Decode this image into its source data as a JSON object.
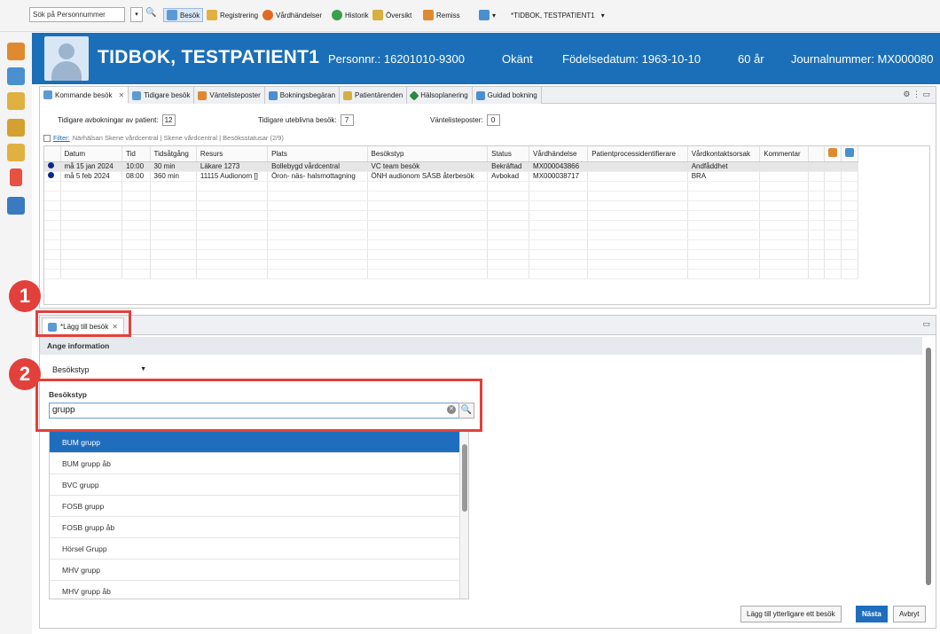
{
  "toolbar": {
    "search_placeholder": "Sök på Personnummer",
    "items": [
      {
        "label": "Besök",
        "icon": "calendar-icon"
      },
      {
        "label": "Registrering",
        "icon": "pencil-icon"
      },
      {
        "label": "Vårdhändelser",
        "icon": "event-icon"
      },
      {
        "label": "Historik",
        "icon": "history-icon"
      },
      {
        "label": "Översikt",
        "icon": "overview-icon"
      },
      {
        "label": "Remiss",
        "icon": "referral-icon"
      }
    ],
    "tab_title": "*TIDBOK, TESTPATIENT1"
  },
  "patient": {
    "name": "TIDBOK, TESTPATIENT1",
    "personnr": "Personnr.: 16201010-9300",
    "gender": "Okänt",
    "birthdate": "Födelsedatum: 1963-10-10",
    "age": "60 år",
    "journal": "Journalnummer: MX000080"
  },
  "upper_tabs": [
    {
      "label": "Kommande besök",
      "icon": "calendar-icon",
      "closable": true
    },
    {
      "label": "Tidigare besök",
      "icon": "calendar-icon"
    },
    {
      "label": "Väntelisteposter",
      "icon": "list-icon"
    },
    {
      "label": "Bokningsbegäran",
      "icon": "booking-icon"
    },
    {
      "label": "Patientärenden",
      "icon": "case-icon"
    },
    {
      "label": "Hälsoplanering",
      "icon": "plan-icon"
    },
    {
      "label": "Guidad bokning",
      "icon": "guided-icon"
    }
  ],
  "stats": {
    "avbokningar_label": "Tidigare avbokningar av patient:",
    "avbokningar_value": "12",
    "uteblivna_label": "Tidigare uteblivna besök:",
    "uteblivna_value": "7",
    "vantelista_label": "Väntelisteposter:",
    "vantelista_value": "0"
  },
  "filter": {
    "link": "Filter:",
    "text": "Närhälsan Skene vårdcentral | Skene vårdcentral | Besöksstatusar (2/9)"
  },
  "table": {
    "headers": [
      "",
      "Datum",
      "Tid",
      "Tidsåtgång",
      "Resurs",
      "Plats",
      "Besökstyp",
      "Status",
      "Vårdhändelse",
      "Patientprocessidentifierare",
      "Vårdkontaktsorsak",
      "Kommentar",
      "",
      "",
      ""
    ],
    "rows": [
      [
        "må 15 jan 2024",
        "10:00",
        "30 min",
        "Läkare 1273",
        "Bollebygd vårdcentral",
        "VC team besök",
        "Bekräftad",
        "MX000043866",
        "",
        "Andfåddhet",
        ""
      ],
      [
        "må 5 feb 2024",
        "08:00",
        "360 min",
        "11115 Audionom []",
        "Öron- näs- halsmottagning",
        "ÖNH audionom SÄSB återbesök",
        "Avbokad",
        "MX000038717",
        "",
        "BRA",
        ""
      ]
    ]
  },
  "lower": {
    "tab_label": "*Lägg till besök",
    "section_title": "Ange information",
    "combo_value": "Besökstyp",
    "field_label": "Besökstyp",
    "field_value": "grupp",
    "options": [
      "BUM grupp",
      "BUM grupp åb",
      "BVC grupp",
      "FOSB grupp",
      "FOSB grupp åb",
      "Hörsel Grupp",
      "MHV grupp",
      "MHV grupp åb"
    ],
    "selected_option": 0,
    "buttons": {
      "add_more": "Lägg till ytterligare ett besök",
      "next": "Nästa",
      "cancel": "Avbryt"
    }
  },
  "callouts": [
    "1",
    "2"
  ],
  "colors": {
    "header_bg": "#1b6fb8",
    "selected": "#1f6ebd",
    "callout": "#e2403b"
  }
}
